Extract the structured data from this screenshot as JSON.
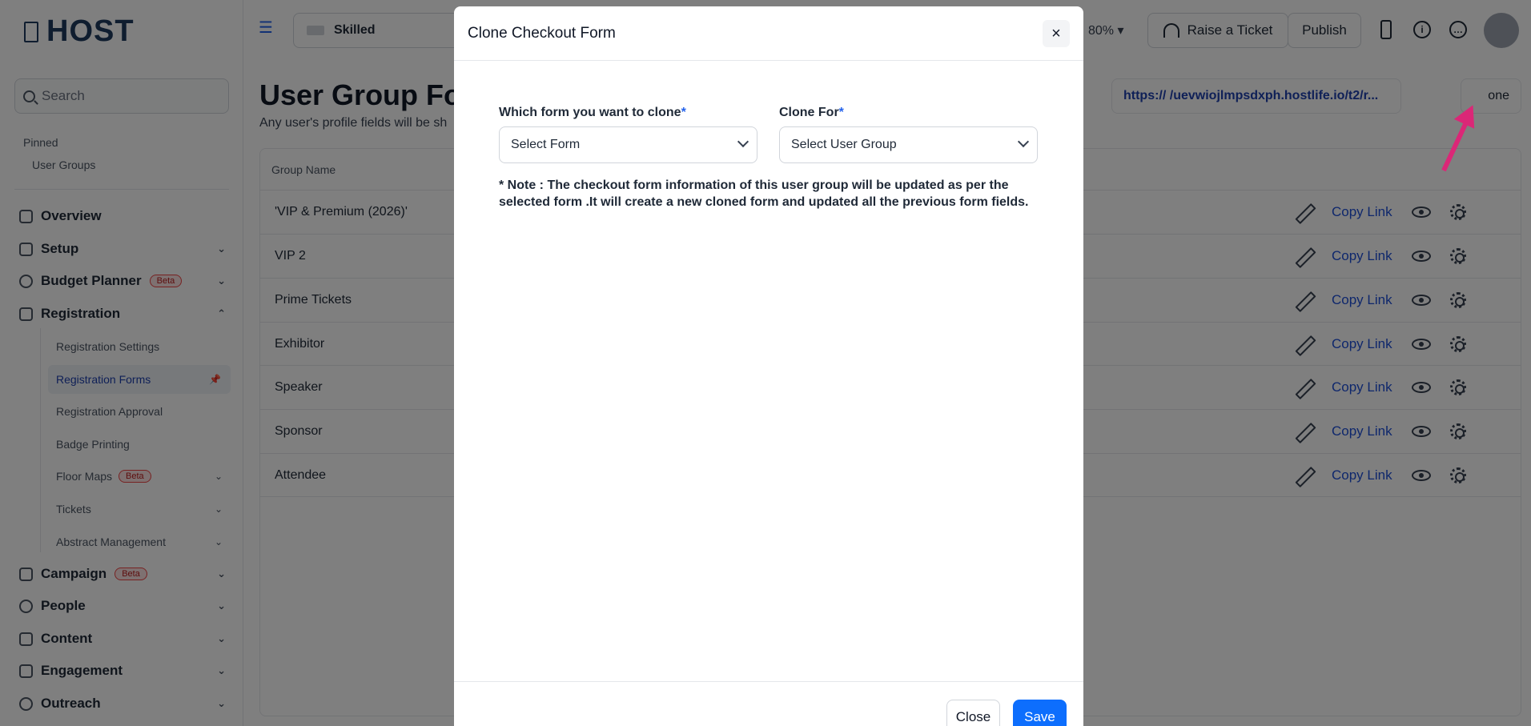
{
  "sidebar": {
    "logo": "HOST",
    "search_placeholder": "Search",
    "pinned_title": "Pinned",
    "pinned_items": [
      "User Groups"
    ],
    "nav": [
      {
        "label": "Overview",
        "icon": "home-icon"
      },
      {
        "label": "Setup",
        "icon": "layers-icon"
      },
      {
        "label": "Budget Planner",
        "icon": "budget-icon",
        "badge": "Beta"
      },
      {
        "label": "Registration",
        "icon": "registration-icon"
      }
    ],
    "registration_sub": [
      {
        "label": "Registration Settings"
      },
      {
        "label": "Registration Forms"
      },
      {
        "label": "Registration Approval"
      },
      {
        "label": "Badge Printing"
      },
      {
        "label": "Floor Maps",
        "badge": "Beta"
      },
      {
        "label": "Tickets"
      },
      {
        "label": "Abstract Management"
      }
    ],
    "nav_bottom": [
      {
        "label": "Campaign",
        "icon": "campaign-icon",
        "badge": "Beta"
      },
      {
        "label": "People",
        "icon": "people-icon"
      },
      {
        "label": "Content",
        "icon": "content-icon"
      },
      {
        "label": "Engagement",
        "icon": "engagement-icon"
      },
      {
        "label": "Outreach",
        "icon": "outreach-icon"
      }
    ]
  },
  "topbar": {
    "event_name": "Skilled",
    "zoom": "80%",
    "raise_ticket": "Raise a Ticket",
    "publish": "Publish"
  },
  "main": {
    "title": "User Group For",
    "subtitle": "Any user's profile fields will be sh",
    "url": "https:// /uevwiojlmpsdxph.hostlife.io/t2/r...",
    "clone_btn": "one",
    "table": {
      "header": "Group Name",
      "copy_link_label": "Copy Link",
      "rows": [
        "'VIP & Premium (2026)'",
        "VIP 2",
        "Prime Tickets",
        "Exhibitor",
        "Speaker",
        "Sponsor",
        "Attendee"
      ]
    }
  },
  "modal": {
    "title": "Clone Checkout Form",
    "close_icon": "×",
    "form_label": "Which form you want to clone",
    "form_value": "Select Form",
    "clone_for_label": "Clone For",
    "clone_for_value": "Select User Group",
    "required_mark": "*",
    "note": "* Note : The checkout form information of this user group will be updated as per the selected form .It will create a new cloned form and updated all the previous form fields.",
    "close_button": "Close",
    "save_button": "Save"
  },
  "colors": {
    "primary": "#0d6efd",
    "link": "#1d4ed8",
    "beta": "#b91c1c",
    "arrow": "#db2777"
  }
}
